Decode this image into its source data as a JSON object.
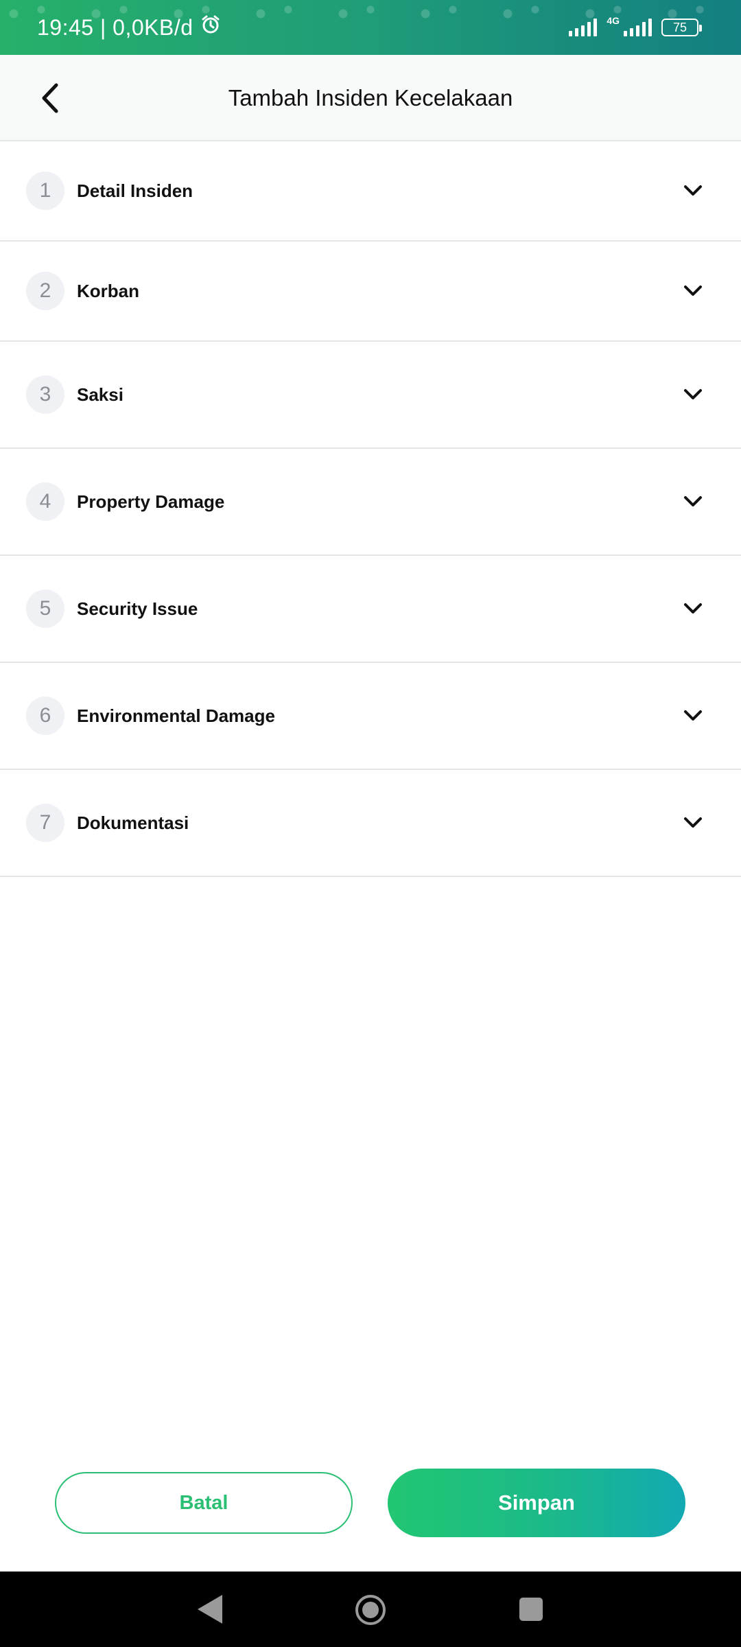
{
  "status_bar": {
    "time_and_speed": "19:45 | 0,0KB/d",
    "network_type": "4G",
    "battery": "75"
  },
  "header": {
    "title": "Tambah Insiden Kecelakaan",
    "back_icon": "chevron-left-icon"
  },
  "sections": [
    {
      "number": "1",
      "label": "Detail Insiden"
    },
    {
      "number": "2",
      "label": "Korban"
    },
    {
      "number": "3",
      "label": "Saksi"
    },
    {
      "number": "4",
      "label": "Property Damage"
    },
    {
      "number": "5",
      "label": "Security Issue"
    },
    {
      "number": "6",
      "label": "Environmental Damage"
    },
    {
      "number": "7",
      "label": "Dokumentasi"
    }
  ],
  "actions": {
    "cancel_label": "Batal",
    "save_label": "Simpan"
  },
  "colors": {
    "accent_green": "#2bbf73",
    "gradient_end": "#14a9b3"
  }
}
